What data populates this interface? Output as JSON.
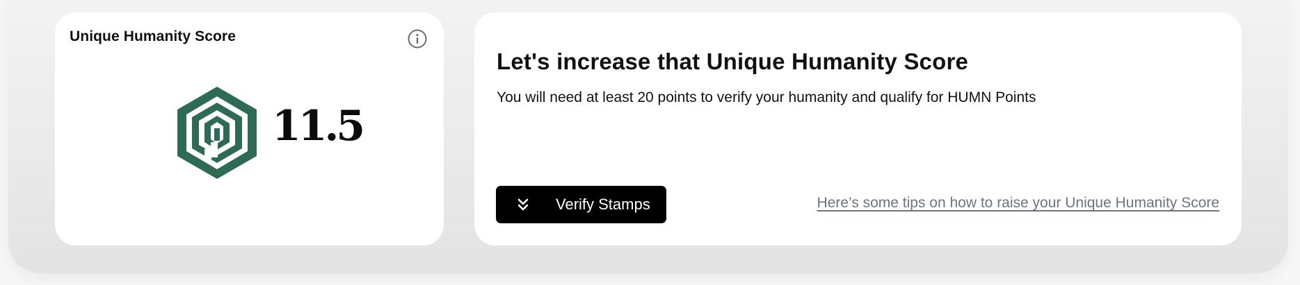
{
  "score_card": {
    "title": "Unique Humanity Score",
    "score": "11.5",
    "icons": {
      "info": "info-icon",
      "logo": "humanity-hexagon-logo"
    },
    "brand_color": "#2e6b55"
  },
  "info_card": {
    "headline": "Let's increase that Unique Humanity Score",
    "subtext": "You will need at least 20 points to verify your humanity and qualify for HUMN Points",
    "verify_button_label": "Verify Stamps",
    "verify_button_icon": "double-chevron-down-icon",
    "tips_link": "Here’s some tips on how to raise your Unique Humanity Score",
    "link_color": "#6b7280"
  }
}
